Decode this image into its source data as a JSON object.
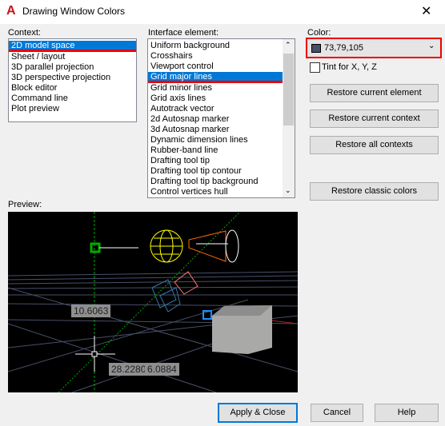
{
  "window": {
    "title": "Drawing Window Colors",
    "close": "✕"
  },
  "context": {
    "label": "Context:",
    "items": [
      "2D model space",
      "Sheet / layout",
      "3D parallel projection",
      "3D perspective projection",
      "Block editor",
      "Command line",
      "Plot preview"
    ],
    "selected": 0
  },
  "interface": {
    "label": "Interface element:",
    "items": [
      "Uniform background",
      "Crosshairs",
      "Viewport control",
      "Grid major lines",
      "Grid minor lines",
      "Grid axis lines",
      "Autotrack vector",
      "2d Autosnap marker",
      "3d Autosnap marker",
      "Dynamic dimension lines",
      "Rubber-band line",
      "Drafting tool tip",
      "Drafting tool tip contour",
      "Drafting tool tip background",
      "Control vertices hull"
    ],
    "selected": 3
  },
  "color": {
    "label": "Color:",
    "value": "73,79,105",
    "swatch": "#494f69",
    "tint_label": "Tint for X, Y, Z",
    "tint_checked": false
  },
  "buttons": {
    "restore_element": "Restore current element",
    "restore_context": "Restore current context",
    "restore_all": "Restore all contexts",
    "restore_classic": "Restore classic colors",
    "apply": "Apply & Close",
    "cancel": "Cancel",
    "help": "Help"
  },
  "preview": {
    "label": "Preview:",
    "dim1": "10.6063",
    "dim2": "28.2280",
    "dim3": "6.0884"
  }
}
